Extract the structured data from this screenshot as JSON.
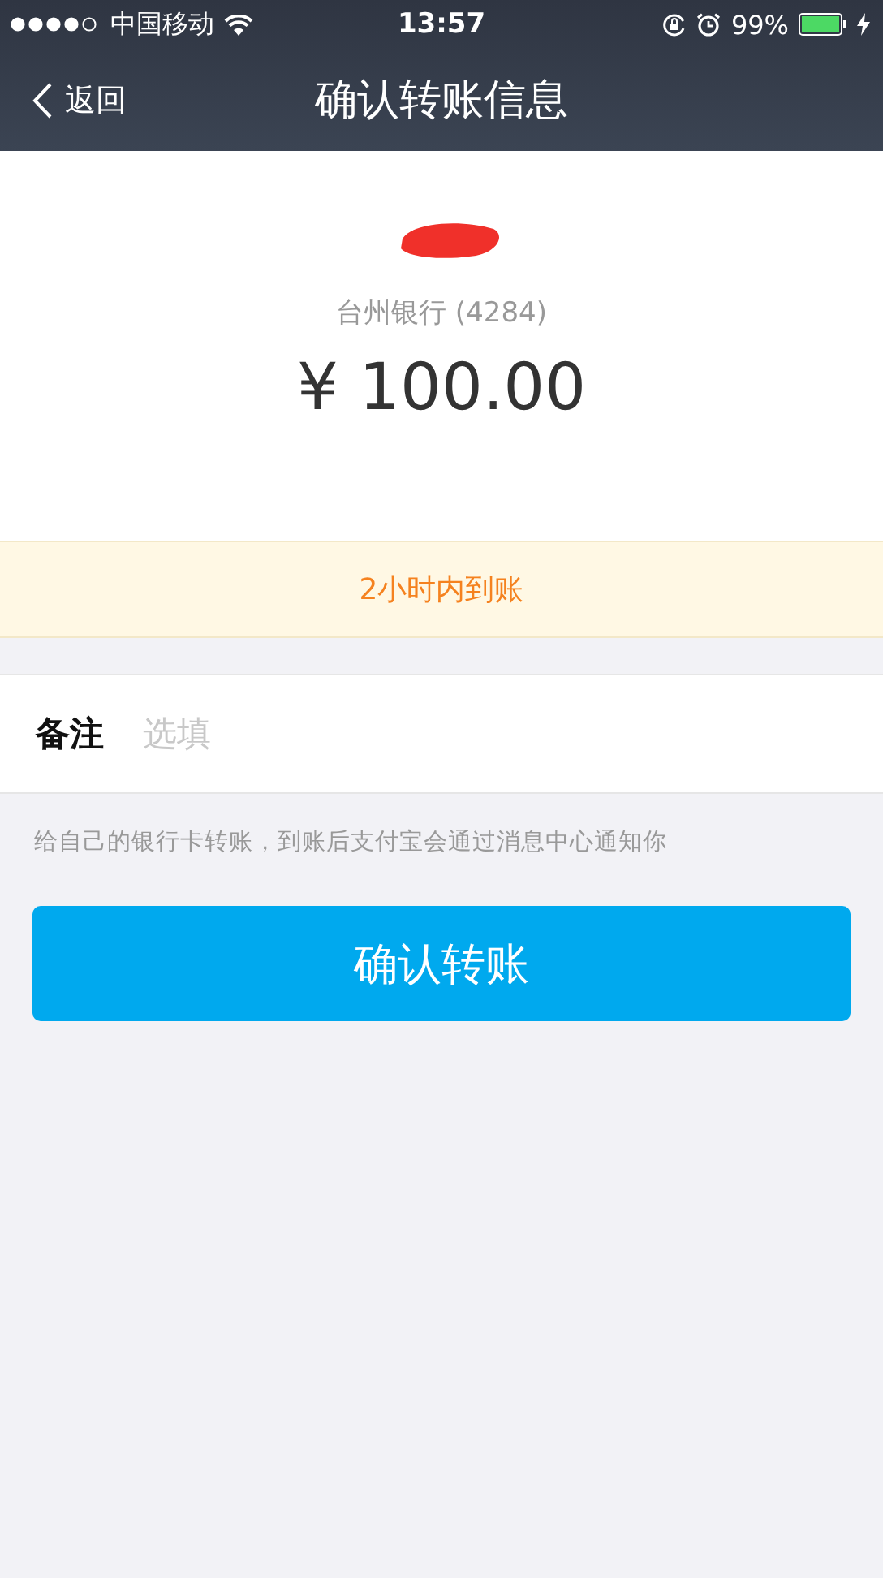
{
  "status_bar": {
    "carrier": "中国移动",
    "time": "13:57",
    "battery": "99%"
  },
  "nav": {
    "back": "返回",
    "title": "确认转账信息"
  },
  "recipient": {
    "bank": "台州银行 (4284)",
    "amount": "¥ 100.00"
  },
  "notice": "2小时内到账",
  "remark": {
    "label": "备注",
    "placeholder": "选填"
  },
  "hint": "给自己的银行卡转账，到账后支付宝会通过消息中心通知你",
  "confirm_button": "确认转账"
}
